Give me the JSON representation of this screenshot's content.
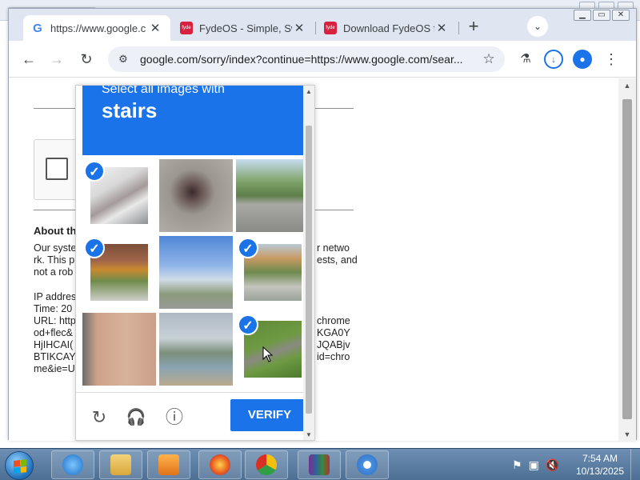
{
  "browser": {
    "tabs": [
      {
        "title": "https://www.google.c",
        "active": true,
        "favicon": "google-g-icon"
      },
      {
        "title": "FydeOS - Simple, Swi",
        "active": false,
        "favicon": "fydeos-icon"
      },
      {
        "title": "Download FydeOS fo",
        "active": false,
        "favicon": "fydeos-icon"
      }
    ],
    "close_glyph": "✕",
    "new_tab_glyph": "+",
    "tab_search_glyph": "⌄",
    "url": "google.com/sorry/index?continue=https://www.google.com/sear...",
    "back_glyph": "←",
    "forward_glyph": "→",
    "reload_glyph": "↻",
    "site_info_glyph": "⚙",
    "star_glyph": "☆",
    "labs_glyph": "⚗",
    "download_glyph": "↓",
    "profile_glyph": "●",
    "menu_glyph": "⋮"
  },
  "page": {
    "about_heading": "About th",
    "lines": [
      "Our syste",
      "rk. This p",
      "not a rob"
    ],
    "right_lines": [
      "r netwo",
      "ests, and"
    ],
    "info_lines": [
      "IP addres",
      "Time: 20",
      "URL: http",
      "od+flec&",
      "HjIHCAI(",
      "BTIKCAY",
      "me&ie=U"
    ],
    "info_right": [
      "chrome",
      "KGA0Y",
      "JQABjv",
      "id=chro"
    ]
  },
  "captcha": {
    "instruction": "Select all images with",
    "target": "stairs",
    "tiles": [
      {
        "subject": "stairs",
        "selected": true
      },
      {
        "subject": "motorcycle-rider",
        "selected": false
      },
      {
        "subject": "street-cars",
        "selected": false
      },
      {
        "subject": "stairs",
        "selected": true
      },
      {
        "subject": "traffic-lights",
        "selected": false
      },
      {
        "subject": "stairs",
        "selected": true
      },
      {
        "subject": "building-wall",
        "selected": false
      },
      {
        "subject": "water-shore",
        "selected": false
      },
      {
        "subject": "stairs",
        "selected": true
      }
    ],
    "check_glyph": "✓",
    "reload_glyph": "↻",
    "audio_glyph": "🎧",
    "info_glyph": "ⓘ",
    "verify_label": "VERIFY"
  },
  "taskbar": {
    "time": "7:54 AM",
    "date": "10/13/2025",
    "apps": [
      "internet-explorer",
      "file-explorer",
      "media-player",
      "firefox",
      "chrome-canary",
      "winrar",
      "chromium"
    ]
  },
  "colors": {
    "accent": "#1a73e8",
    "tabstrip": "#dfe6f1",
    "taskbar": "#4d6f94"
  }
}
